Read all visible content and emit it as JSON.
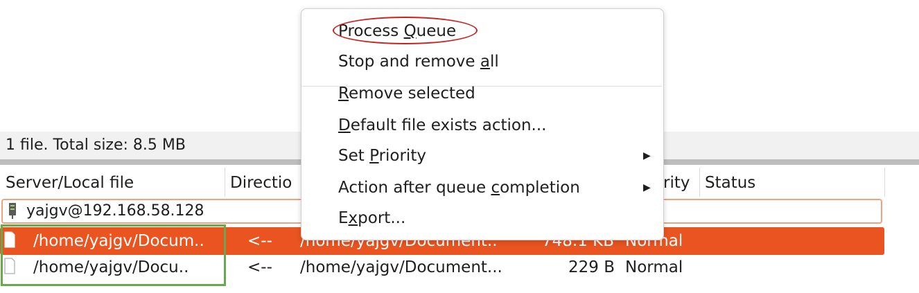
{
  "status_bar": {
    "text": "1 file. Total size: 8.5 MB"
  },
  "columns": {
    "server_local_file": "Server/Local file",
    "direction": "Directio",
    "priority": "rity",
    "status": "Status"
  },
  "server": {
    "label": "yajgv@192.168.58.128"
  },
  "rows": [
    {
      "local": "/home/yajgv/Docum..",
      "direction": "<--",
      "remote": "/home/yajgv/Document..",
      "size": "748.1 KB",
      "priority": "Normal"
    },
    {
      "local": "/home/yajgv/Docu..",
      "direction": "<--",
      "remote": "/home/yajgv/Document...",
      "size": "229 B",
      "priority": "Normal"
    }
  ],
  "menu": {
    "process_queue": {
      "pre": "Process ",
      "ul": "Q",
      "post": "ueue"
    },
    "stop_remove_all": {
      "pre": "Stop and remove ",
      "ul": "a",
      "post": "ll"
    },
    "remove_selected": {
      "pre": "",
      "ul": "R",
      "post": "emove selected"
    },
    "default_file_exists": {
      "pre": "",
      "ul": "D",
      "post": "efault file exists action..."
    },
    "set_priority": {
      "pre": "Set ",
      "ul": "P",
      "post": "riority"
    },
    "action_after_queue": {
      "pre": "Action after queue ",
      "ul": "c",
      "post": "ompletion"
    },
    "export": {
      "pre": "E",
      "ul": "x",
      "post": "port..."
    }
  },
  "colors": {
    "accent": "#e95420",
    "highlight_green": "#6aa84f",
    "highlight_red": "#cc1f1f"
  },
  "icons": {
    "server": "server-icon",
    "file": "file-icon",
    "submenu": "submenu-arrow-icon"
  }
}
